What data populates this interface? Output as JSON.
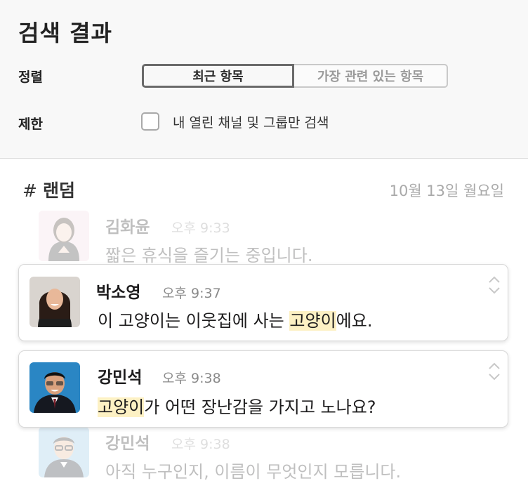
{
  "header": {
    "title": "검색 결과",
    "sort_label": "정렬",
    "sort_options": [
      "최근 항목",
      "가장 관련 있는 항목"
    ],
    "sort_selected": "최근 항목",
    "filter_label": "제한",
    "filter_checkbox_label": "내 열린 채널 및 그룹만 검색",
    "filter_checked": false
  },
  "results": {
    "channel_hash": "#",
    "channel_name": "랜덤",
    "date": "10월 13일 월요일",
    "messages": [
      {
        "name": "김화윤",
        "time": "오후 9:33",
        "text": "짧은 휴식을 즐기는 중입니다.",
        "faded": true
      },
      {
        "name": "박소영",
        "time": "오후 9:37",
        "text_before": "이 고양이는 이웃집에 사는 ",
        "highlight": "고양이",
        "text_after": "에요.",
        "faded": false
      },
      {
        "name": "강민석",
        "time": "오후 9:38",
        "text_before": "",
        "highlight": "고양이",
        "text_after": "가 어떤 장난감을 가지고 노나요?",
        "faded": false
      },
      {
        "name": "강민석",
        "time": "오후 9:38",
        "text": "아직 누구인지, 이름이 무엇인지 모릅니다.",
        "faded": true
      }
    ]
  },
  "colors": {
    "highlight": "#fdf1c4",
    "header_bg": "#f8f8f8",
    "muted_text": "#a9a9a9"
  },
  "icons": [
    "hash-icon",
    "checkbox-icon",
    "chevron-up-down-icon"
  ]
}
